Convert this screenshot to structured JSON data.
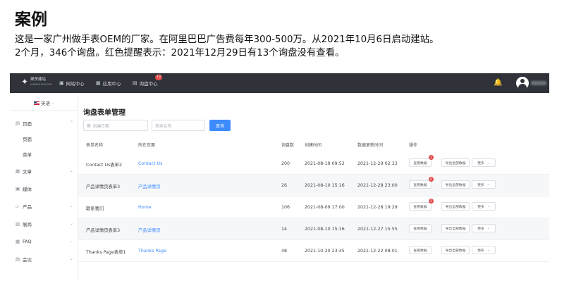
{
  "slide": {
    "title": "案例",
    "line1": "这是一家广州做手表OEM的厂家。在阿里巴巴广告费每年300-500万。从2021年10月6日启动建站。",
    "line2": "2个月，346个询盘。红色提醒表示：2021年12月29日有13个询盘没有查看。"
  },
  "topbar": {
    "logo_name": "聚贸建站",
    "logo_sub": "JUMORE BUILDER",
    "nav": [
      {
        "label": "网站中心",
        "icon": "monitor-icon"
      },
      {
        "label": "应用中心",
        "icon": "app-icon"
      },
      {
        "label": "询盘中心",
        "icon": "inbox-icon"
      }
    ],
    "inquiry_badge": "13",
    "bell_icon": "bell-icon",
    "avatar_icon": "user-icon"
  },
  "sidebar": {
    "language": "英语",
    "items": [
      {
        "label": "页面",
        "icon": "page-icon",
        "has_chevron": true
      },
      {
        "label": "页面",
        "sub": true
      },
      {
        "label": "菜单",
        "sub": true
      },
      {
        "label": "文章",
        "icon": "article-icon",
        "has_chevron": true
      },
      {
        "label": "媒体",
        "icon": "media-icon",
        "has_chevron": false
      },
      {
        "label": "产品",
        "icon": "product-icon",
        "has_chevron": true
      },
      {
        "label": "展商",
        "icon": "exhibitor-icon",
        "has_chevron": true
      },
      {
        "label": "FAQ",
        "icon": "faq-icon",
        "has_chevron": true
      },
      {
        "label": "会议",
        "icon": "meeting-icon",
        "has_chevron": true
      }
    ]
  },
  "main": {
    "title": "询盘表单管理",
    "filter": {
      "date_placeholder": "创建日期",
      "name_placeholder": "表单名称",
      "query_label": "查询"
    },
    "columns": [
      "表单名称",
      "所在页面",
      "询盘数",
      "创建时间",
      "数据更新时间",
      "操作"
    ],
    "rows": [
      {
        "name": "Contact Us表单2",
        "page": "Contact Us",
        "count": "200",
        "created": "2021-08-19 09:52",
        "updated": "2021-12-29 02:33",
        "badge": "2",
        "alt": false
      },
      {
        "name": "产品详情页表单3",
        "page": "产品详情页",
        "count": "26",
        "created": "2021-08-10 15:16",
        "updated": "2021-12-28 23:00",
        "badge": "6",
        "alt": true
      },
      {
        "name": "联系我们",
        "page": "Home",
        "count": "106",
        "created": "2021-08-09 17:00",
        "updated": "2021-12-28 19:29",
        "badge": "5",
        "alt": false
      },
      {
        "name": "产品详情页表单3",
        "page": "产品详情页",
        "count": "14",
        "created": "2021-08-10 15:16",
        "updated": "2021-12-27 15:55",
        "badge": "",
        "alt": true
      },
      {
        "name": "Thanks Page表单1",
        "page": "Thanks Page",
        "count": "48",
        "created": "2021-10-20 23:45",
        "updated": "2021-12-22 08:01",
        "badge": "",
        "alt": false
      }
    ],
    "actions": {
      "view": "查看数据",
      "export": "导出全部数据",
      "more": "更多"
    }
  }
}
